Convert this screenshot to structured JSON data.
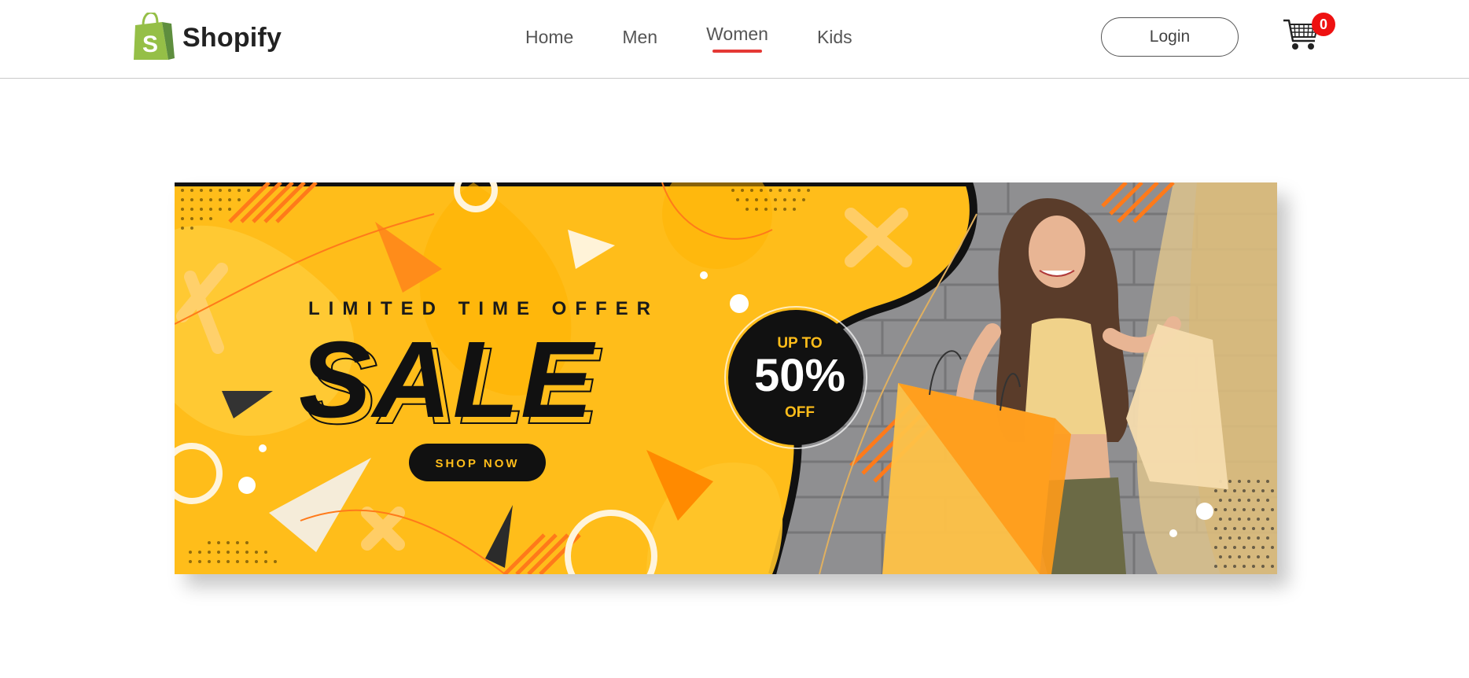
{
  "brand": {
    "name": "Shopify",
    "logo_icon": "shopify-bag-icon",
    "logo_letter": "S",
    "color": "#95bf47"
  },
  "nav": {
    "items": [
      {
        "label": "Home",
        "active": false
      },
      {
        "label": "Men",
        "active": false
      },
      {
        "label": "Women",
        "active": true
      },
      {
        "label": "Kids",
        "active": false
      }
    ],
    "active_color": "#e53935"
  },
  "header": {
    "login_label": "Login",
    "cart_icon": "shopping-cart-icon",
    "cart_count": "0",
    "badge_color": "#ee1111"
  },
  "banner": {
    "tagline": "LIMITED TIME OFFER",
    "headline": "SALE",
    "cta_label": "SHOP NOW",
    "badge_top": "UP TO",
    "badge_value": "50%",
    "badge_bottom": "OFF",
    "accent_color": "#ffbd1a"
  }
}
